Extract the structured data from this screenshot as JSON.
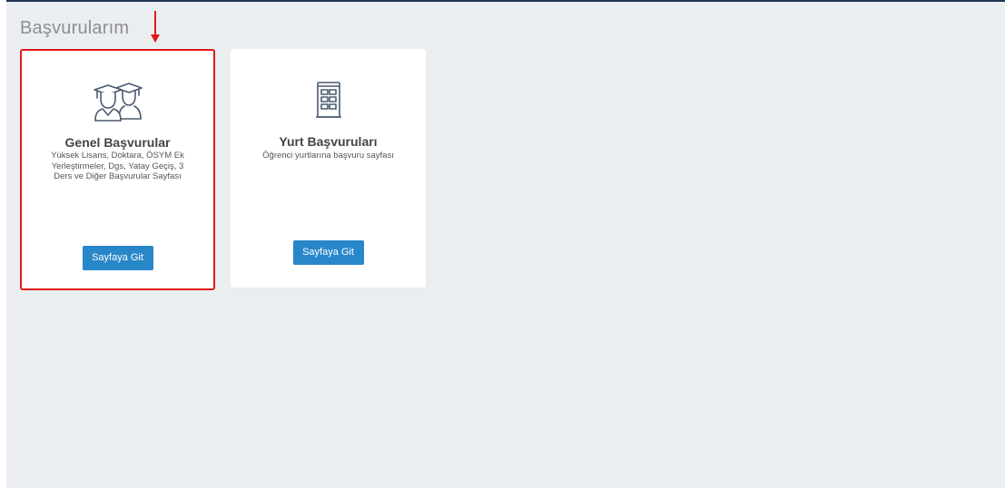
{
  "page": {
    "title": "Başvurularım"
  },
  "cards": [
    {
      "icon": "graduates-icon",
      "title": "Genel Başvurular",
      "description": "Yüksek Lisans, Doktara, ÖSYM Ek Yerleştirmeler, Dgs, Yatay Geçiş, 3 Ders ve Diğer Başvurular Sayfası",
      "button_label": "Sayfaya Git",
      "highlighted": true
    },
    {
      "icon": "building-icon",
      "title": "Yurt Başvuruları",
      "description": "Öğrenci yurtlarına başvuru sayfası",
      "button_label": "Sayfaya Git",
      "highlighted": false
    }
  ],
  "colors": {
    "background": "#ebeef1",
    "top_border": "#1f3557",
    "button": "#2887c9",
    "highlight": "#e01a1a",
    "icon": "#4a5a6f"
  }
}
